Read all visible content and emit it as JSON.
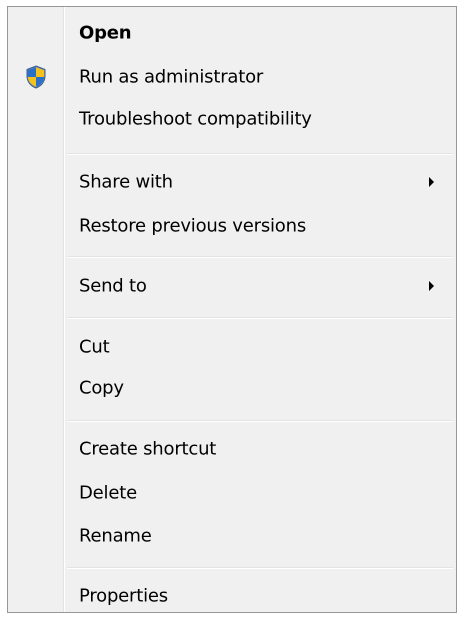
{
  "menu": {
    "open": "Open",
    "run_as_admin": "Run as administrator",
    "troubleshoot": "Troubleshoot compatibility",
    "share_with": "Share with",
    "restore_versions": "Restore previous versions",
    "send_to": "Send to",
    "cut": "Cut",
    "copy": "Copy",
    "create_shortcut": "Create shortcut",
    "delete": "Delete",
    "rename": "Rename",
    "properties": "Properties"
  },
  "icons": {
    "run_as_admin": "uac-shield-icon",
    "share_with_submenu": "submenu-arrow-icon",
    "send_to_submenu": "submenu-arrow-icon"
  },
  "colors": {
    "menu_background": "#f0f0f0",
    "menu_border": "#979797",
    "separator": "#e2e3e3",
    "shield_blue": "#2a6fc9",
    "shield_yellow": "#f5c21b"
  }
}
